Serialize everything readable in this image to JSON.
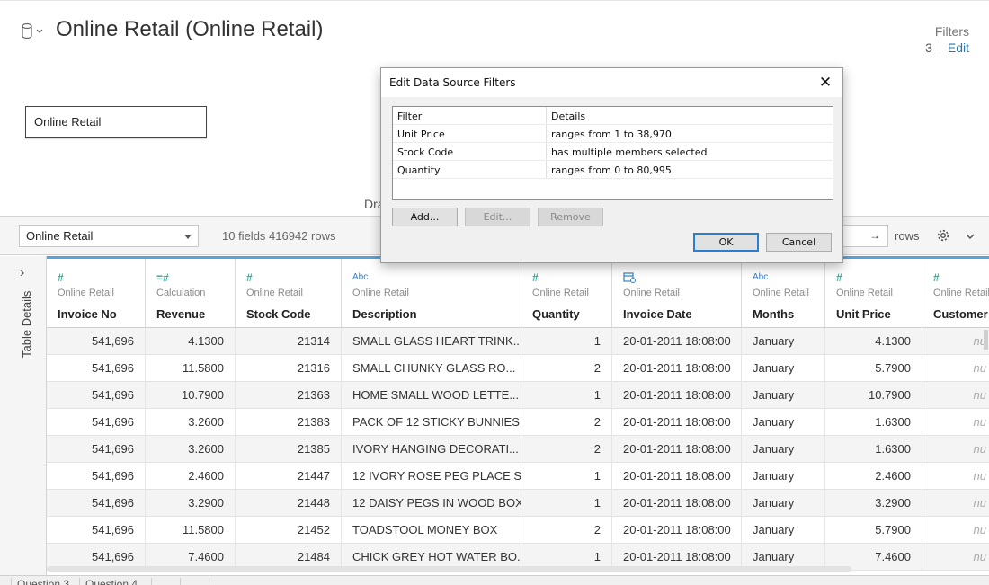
{
  "header": {
    "title": "Online Retail (Online Retail)",
    "filters_label": "Filters",
    "filters_count": "3",
    "filters_edit": "Edit"
  },
  "canvas": {
    "table_card": "Online Retail",
    "drag_hint": "Dra"
  },
  "toolbar": {
    "table_select": "Online Retail",
    "fields_info": "10 fields 416942 rows",
    "rows_value": "→",
    "rows_label": "rows"
  },
  "side": {
    "label": "Table Details",
    "expand": "›"
  },
  "columns": [
    {
      "type": "#",
      "source": "Online Retail",
      "name": "Invoice No"
    },
    {
      "type": "=#",
      "source": "Calculation",
      "name": "Revenue"
    },
    {
      "type": "#",
      "source": "Online Retail",
      "name": "Stock Code"
    },
    {
      "type": "Abc",
      "source": "Online Retail",
      "name": "Description"
    },
    {
      "type": "#",
      "source": "Online Retail",
      "name": "Quantity"
    },
    {
      "type": "date",
      "source": "Online Retail",
      "name": "Invoice Date"
    },
    {
      "type": "Abc",
      "source": "Online Retail",
      "name": "Months"
    },
    {
      "type": "#",
      "source": "Online Retail",
      "name": "Unit Price"
    },
    {
      "type": "#",
      "source": "Online Retail",
      "name": "Customer"
    }
  ],
  "rows": [
    [
      "541,696",
      "4.1300",
      "21314",
      "SMALL GLASS HEART TRINK...",
      "1",
      "20-01-2011 18:08:00",
      "January",
      "4.1300",
      "nu"
    ],
    [
      "541,696",
      "11.5800",
      "21316",
      "SMALL CHUNKY GLASS RO...",
      "2",
      "20-01-2011 18:08:00",
      "January",
      "5.7900",
      "nu"
    ],
    [
      "541,696",
      "10.7900",
      "21363",
      "HOME SMALL WOOD LETTE...",
      "1",
      "20-01-2011 18:08:00",
      "January",
      "10.7900",
      "nu"
    ],
    [
      "541,696",
      "3.2600",
      "21383",
      "PACK OF 12 STICKY BUNNIES",
      "2",
      "20-01-2011 18:08:00",
      "January",
      "1.6300",
      "nu"
    ],
    [
      "541,696",
      "3.2600",
      "21385",
      "IVORY HANGING DECORATI...",
      "2",
      "20-01-2011 18:08:00",
      "January",
      "1.6300",
      "nu"
    ],
    [
      "541,696",
      "2.4600",
      "21447",
      "12 IVORY ROSE PEG PLACE S...",
      "1",
      "20-01-2011 18:08:00",
      "January",
      "2.4600",
      "nu"
    ],
    [
      "541,696",
      "3.2900",
      "21448",
      "12 DAISY PEGS IN WOOD BOX",
      "1",
      "20-01-2011 18:08:00",
      "January",
      "3.2900",
      "nu"
    ],
    [
      "541,696",
      "11.5800",
      "21452",
      "TOADSTOOL MONEY BOX",
      "2",
      "20-01-2011 18:08:00",
      "January",
      "5.7900",
      "nu"
    ],
    [
      "541,696",
      "7.4600",
      "21484",
      "CHICK GREY HOT WATER BO...",
      "1",
      "20-01-2011 18:08:00",
      "January",
      "7.4600",
      "nu"
    ]
  ],
  "bottom_tabs": [
    "Question 3",
    "Question 4"
  ],
  "dialog": {
    "title": "Edit Data Source Filters",
    "close": "✕",
    "col_filter": "Filter",
    "col_details": "Details",
    "filters": [
      {
        "filter": "Unit Price",
        "details": "ranges from 1 to 38,970"
      },
      {
        "filter": "Stock Code",
        "details": "has multiple members selected"
      },
      {
        "filter": "Quantity",
        "details": "ranges from 0 to 80,995"
      }
    ],
    "btn_add": "Add...",
    "btn_edit": "Edit...",
    "btn_remove": "Remove",
    "btn_ok": "OK",
    "btn_cancel": "Cancel"
  },
  "colors": {
    "accent_blue": "#1f77b4",
    "header_bar": "#5aa3d9",
    "measure_icon": "#3a9e8e",
    "dimension_icon": "#3a7fc1"
  }
}
